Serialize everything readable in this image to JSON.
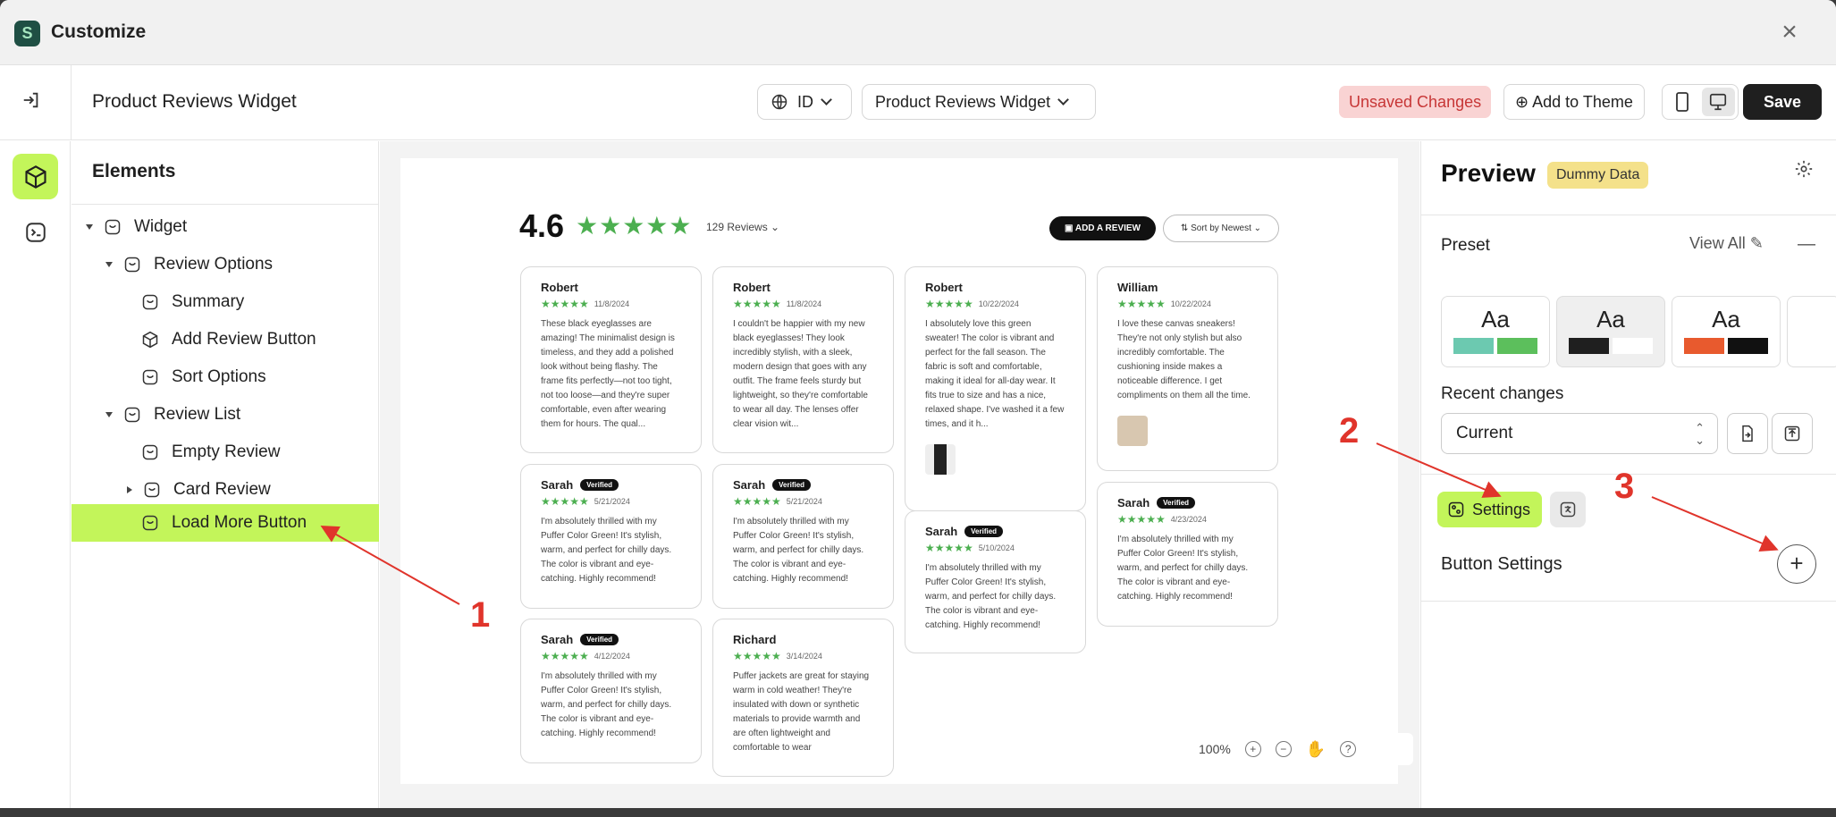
{
  "window": {
    "title": "Customize"
  },
  "topbar": {
    "widget_name": "Product Reviews Widget",
    "language": "ID",
    "widget_select": "Product Reviews Widget",
    "unsaved": "Unsaved Changes",
    "add_to_theme": "Add to Theme",
    "save": "Save"
  },
  "elements": {
    "title": "Elements",
    "tree": [
      "Widget",
      "Review Options",
      "Summary",
      "Add Review Button",
      "Sort Options",
      "Review List",
      "Empty Review",
      "Card Review",
      "Load More Button"
    ]
  },
  "canvas": {
    "rating": "4.6",
    "stars": "★★★★★",
    "review_count": "129 Reviews",
    "add_review": "ADD A REVIEW",
    "sort": "Sort by Newest",
    "zoom": "100%",
    "cards": [
      {
        "name": "Robert",
        "verified": "",
        "date": "11/8/2024",
        "text": "These black eyeglasses are amazing! The minimalist design is timeless, and they add a polished look without being flashy. The frame fits perfectly—not too tight, not too loose—and they're super comfortable, even after wearing them for hours. The qual..."
      },
      {
        "name": "Robert",
        "verified": "",
        "date": "11/8/2024",
        "text": "I couldn't be happier with my new black eyeglasses! They look incredibly stylish, with a sleek, modern design that goes with any outfit. The frame feels sturdy but lightweight, so they're comfortable to wear all day. The lenses offer clear vision wit..."
      },
      {
        "name": "Robert",
        "verified": "",
        "date": "10/22/2024",
        "text": "I absolutely love this green sweater! The color is vibrant and perfect for the fall season. The fabric is soft and comfortable, making it ideal for all-day wear. It fits true to size and has a nice, relaxed shape. I've washed it a few times, and it h..."
      },
      {
        "name": "William",
        "verified": "",
        "date": "10/22/2024",
        "text": "I love these canvas sneakers! They're not only stylish but also incredibly comfortable. The cushioning inside makes a noticeable difference. I get compliments on them all the time."
      },
      {
        "name": "Sarah",
        "verified": "Verified",
        "date": "5/21/2024",
        "text": "I'm absolutely thrilled with my Puffer Color Green! It's stylish, warm, and perfect for chilly days. The color is vibrant and eye-catching. Highly recommend!"
      },
      {
        "name": "Sarah",
        "verified": "Verified",
        "date": "5/21/2024",
        "text": "I'm absolutely thrilled with my Puffer Color Green! It's stylish, warm, and perfect for chilly days. The color is vibrant and eye-catching. Highly recommend!"
      },
      {
        "name": "Sarah",
        "verified": "Verified",
        "date": "5/10/2024",
        "text": "I'm absolutely thrilled with my Puffer Color Green! It's stylish, warm, and perfect for chilly days. The color is vibrant and eye-catching. Highly recommend!"
      },
      {
        "name": "Sarah",
        "verified": "Verified",
        "date": "4/23/2024",
        "text": "I'm absolutely thrilled with my Puffer Color Green! It's stylish, warm, and perfect for chilly days. The color is vibrant and eye-catching. Highly recommend!"
      },
      {
        "name": "Sarah",
        "verified": "Verified",
        "date": "4/12/2024",
        "text": "I'm absolutely thrilled with my Puffer Color Green! It's stylish, warm, and perfect for chilly days. The color is vibrant and eye-catching. Highly recommend!"
      },
      {
        "name": "Richard",
        "verified": "",
        "date": "3/14/2024",
        "text": "Puffer jackets are great for staying warm in cold weather! They're insulated with down or synthetic materials to provide warmth and are often lightweight and comfortable to wear"
      }
    ]
  },
  "right_panel": {
    "title": "Preview",
    "badge": "Dummy Data",
    "preset_label": "Preset",
    "view_all": "View All",
    "preset_aa": [
      "Aa",
      "Aa",
      "Aa"
    ],
    "preset_colors": [
      [
        "#6cc9b0",
        "#5cbf5c"
      ],
      [
        "#1f1f1f",
        "#ffffff"
      ],
      [
        "#e85a2e",
        "#111111"
      ]
    ],
    "recent_label": "Recent changes",
    "recent_value": "Current",
    "settings_tab": "Settings",
    "button_settings": "Button Settings"
  },
  "annotations": [
    "1",
    "2",
    "3"
  ],
  "colors": {
    "accent": "#c3f55a",
    "star": "#4caf50",
    "annotation": "#e0342b"
  }
}
